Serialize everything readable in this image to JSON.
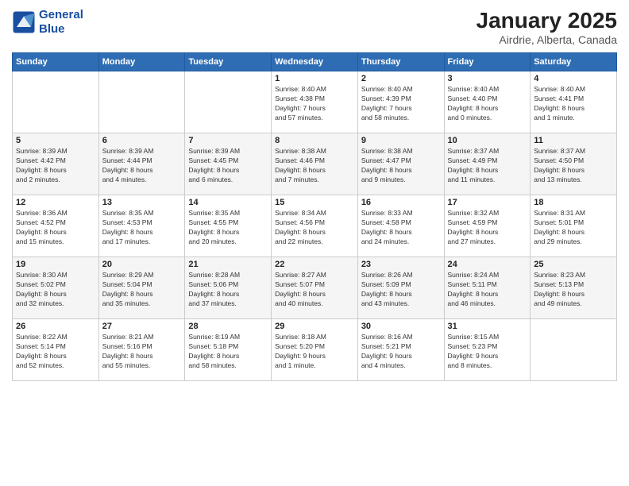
{
  "header": {
    "logo_line1": "General",
    "logo_line2": "Blue",
    "month": "January 2025",
    "location": "Airdrie, Alberta, Canada"
  },
  "days_of_week": [
    "Sunday",
    "Monday",
    "Tuesday",
    "Wednesday",
    "Thursday",
    "Friday",
    "Saturday"
  ],
  "weeks": [
    [
      {
        "day": "",
        "info": ""
      },
      {
        "day": "",
        "info": ""
      },
      {
        "day": "",
        "info": ""
      },
      {
        "day": "1",
        "info": "Sunrise: 8:40 AM\nSunset: 4:38 PM\nDaylight: 7 hours\nand 57 minutes."
      },
      {
        "day": "2",
        "info": "Sunrise: 8:40 AM\nSunset: 4:39 PM\nDaylight: 7 hours\nand 58 minutes."
      },
      {
        "day": "3",
        "info": "Sunrise: 8:40 AM\nSunset: 4:40 PM\nDaylight: 8 hours\nand 0 minutes."
      },
      {
        "day": "4",
        "info": "Sunrise: 8:40 AM\nSunset: 4:41 PM\nDaylight: 8 hours\nand 1 minute."
      }
    ],
    [
      {
        "day": "5",
        "info": "Sunrise: 8:39 AM\nSunset: 4:42 PM\nDaylight: 8 hours\nand 2 minutes."
      },
      {
        "day": "6",
        "info": "Sunrise: 8:39 AM\nSunset: 4:44 PM\nDaylight: 8 hours\nand 4 minutes."
      },
      {
        "day": "7",
        "info": "Sunrise: 8:39 AM\nSunset: 4:45 PM\nDaylight: 8 hours\nand 6 minutes."
      },
      {
        "day": "8",
        "info": "Sunrise: 8:38 AM\nSunset: 4:46 PM\nDaylight: 8 hours\nand 7 minutes."
      },
      {
        "day": "9",
        "info": "Sunrise: 8:38 AM\nSunset: 4:47 PM\nDaylight: 8 hours\nand 9 minutes."
      },
      {
        "day": "10",
        "info": "Sunrise: 8:37 AM\nSunset: 4:49 PM\nDaylight: 8 hours\nand 11 minutes."
      },
      {
        "day": "11",
        "info": "Sunrise: 8:37 AM\nSunset: 4:50 PM\nDaylight: 8 hours\nand 13 minutes."
      }
    ],
    [
      {
        "day": "12",
        "info": "Sunrise: 8:36 AM\nSunset: 4:52 PM\nDaylight: 8 hours\nand 15 minutes."
      },
      {
        "day": "13",
        "info": "Sunrise: 8:35 AM\nSunset: 4:53 PM\nDaylight: 8 hours\nand 17 minutes."
      },
      {
        "day": "14",
        "info": "Sunrise: 8:35 AM\nSunset: 4:55 PM\nDaylight: 8 hours\nand 20 minutes."
      },
      {
        "day": "15",
        "info": "Sunrise: 8:34 AM\nSunset: 4:56 PM\nDaylight: 8 hours\nand 22 minutes."
      },
      {
        "day": "16",
        "info": "Sunrise: 8:33 AM\nSunset: 4:58 PM\nDaylight: 8 hours\nand 24 minutes."
      },
      {
        "day": "17",
        "info": "Sunrise: 8:32 AM\nSunset: 4:59 PM\nDaylight: 8 hours\nand 27 minutes."
      },
      {
        "day": "18",
        "info": "Sunrise: 8:31 AM\nSunset: 5:01 PM\nDaylight: 8 hours\nand 29 minutes."
      }
    ],
    [
      {
        "day": "19",
        "info": "Sunrise: 8:30 AM\nSunset: 5:02 PM\nDaylight: 8 hours\nand 32 minutes."
      },
      {
        "day": "20",
        "info": "Sunrise: 8:29 AM\nSunset: 5:04 PM\nDaylight: 8 hours\nand 35 minutes."
      },
      {
        "day": "21",
        "info": "Sunrise: 8:28 AM\nSunset: 5:06 PM\nDaylight: 8 hours\nand 37 minutes."
      },
      {
        "day": "22",
        "info": "Sunrise: 8:27 AM\nSunset: 5:07 PM\nDaylight: 8 hours\nand 40 minutes."
      },
      {
        "day": "23",
        "info": "Sunrise: 8:26 AM\nSunset: 5:09 PM\nDaylight: 8 hours\nand 43 minutes."
      },
      {
        "day": "24",
        "info": "Sunrise: 8:24 AM\nSunset: 5:11 PM\nDaylight: 8 hours\nand 46 minutes."
      },
      {
        "day": "25",
        "info": "Sunrise: 8:23 AM\nSunset: 5:13 PM\nDaylight: 8 hours\nand 49 minutes."
      }
    ],
    [
      {
        "day": "26",
        "info": "Sunrise: 8:22 AM\nSunset: 5:14 PM\nDaylight: 8 hours\nand 52 minutes."
      },
      {
        "day": "27",
        "info": "Sunrise: 8:21 AM\nSunset: 5:16 PM\nDaylight: 8 hours\nand 55 minutes."
      },
      {
        "day": "28",
        "info": "Sunrise: 8:19 AM\nSunset: 5:18 PM\nDaylight: 8 hours\nand 58 minutes."
      },
      {
        "day": "29",
        "info": "Sunrise: 8:18 AM\nSunset: 5:20 PM\nDaylight: 9 hours\nand 1 minute."
      },
      {
        "day": "30",
        "info": "Sunrise: 8:16 AM\nSunset: 5:21 PM\nDaylight: 9 hours\nand 4 minutes."
      },
      {
        "day": "31",
        "info": "Sunrise: 8:15 AM\nSunset: 5:23 PM\nDaylight: 9 hours\nand 8 minutes."
      },
      {
        "day": "",
        "info": ""
      }
    ]
  ]
}
